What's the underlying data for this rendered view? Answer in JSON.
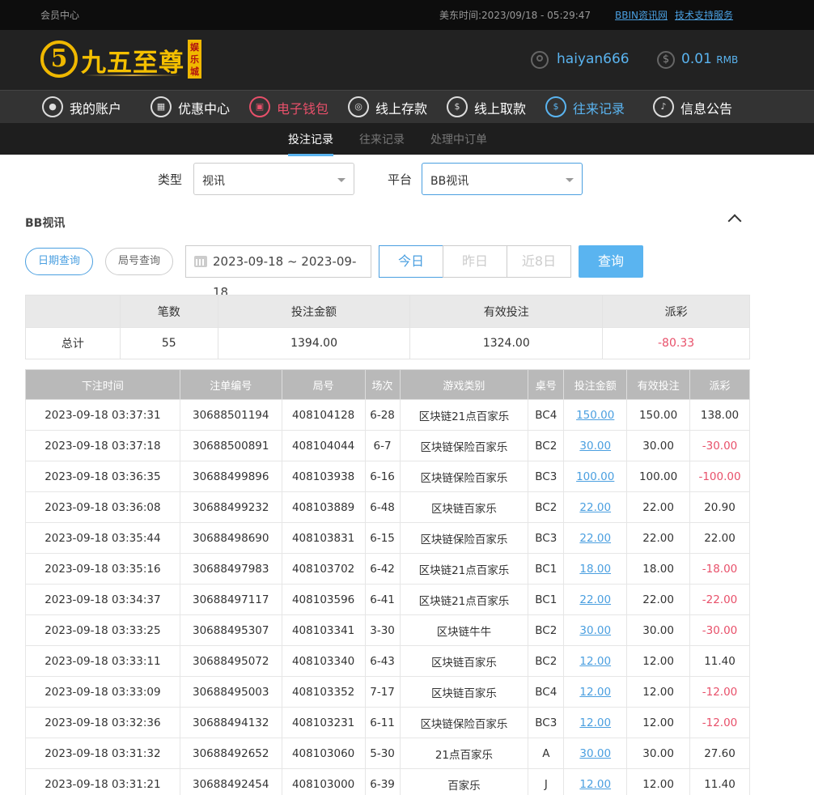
{
  "topbar": {
    "member_center": "会员中心",
    "time_label": "美东时间:",
    "time_value": "2023/09/18 - 05:29:47",
    "link1": "BBIN资讯网",
    "link2": "技术支持服务"
  },
  "logo": {
    "digit": "5",
    "name": "九五至尊",
    "tag": "娱乐城"
  },
  "user": {
    "username": "haiyan666",
    "balance": "0.01",
    "currency": "RMB"
  },
  "nav": [
    {
      "label": "我的账户",
      "icon": "user-icon"
    },
    {
      "label": "优惠中心",
      "icon": "gift-icon"
    },
    {
      "label": "电子钱包",
      "icon": "wallet-icon"
    },
    {
      "label": "线上存款",
      "icon": "deposit-icon"
    },
    {
      "label": "线上取款",
      "icon": "withdraw-icon"
    },
    {
      "label": "往来记录",
      "icon": "records-icon"
    },
    {
      "label": "信息公告",
      "icon": "bell-icon"
    }
  ],
  "subtabs": [
    "投注记录",
    "往来记录",
    "处理中订单"
  ],
  "filters": {
    "type_label": "类型",
    "type_value": "视讯",
    "platform_label": "平台",
    "platform_value": "BB视讯"
  },
  "section_title": "BB视讯",
  "query_modes": [
    "日期查询",
    "局号查询"
  ],
  "date_range": "2023-09-18 ~ 2023-09-18",
  "quick_dates": [
    "今日",
    "昨日",
    "近8日"
  ],
  "query_button": "查询",
  "summary": {
    "headers": [
      "",
      "笔数",
      "投注金额",
      "有效投注",
      "派彩"
    ],
    "row": [
      "总计",
      "55",
      "1394.00",
      "1324.00",
      "-80.33"
    ]
  },
  "records": {
    "headers": [
      "下注时间",
      "注单编号",
      "局号",
      "场次",
      "游戏类别",
      "桌号",
      "投注金额",
      "有效投注",
      "派彩"
    ],
    "rows": [
      [
        "2023-09-18 03:37:31",
        "30688501194",
        "408104128",
        "6-28",
        "区块链21点百家乐",
        "BC4",
        "150.00",
        "150.00",
        "138.00"
      ],
      [
        "2023-09-18 03:37:18",
        "30688500891",
        "408104044",
        "6-7",
        "区块链保险百家乐",
        "BC2",
        "30.00",
        "30.00",
        "-30.00"
      ],
      [
        "2023-09-18 03:36:35",
        "30688499896",
        "408103938",
        "6-16",
        "区块链保险百家乐",
        "BC3",
        "100.00",
        "100.00",
        "-100.00"
      ],
      [
        "2023-09-18 03:36:08",
        "30688499232",
        "408103889",
        "6-48",
        "区块链百家乐",
        "BC2",
        "22.00",
        "22.00",
        "20.90"
      ],
      [
        "2023-09-18 03:35:44",
        "30688498690",
        "408103831",
        "6-15",
        "区块链保险百家乐",
        "BC3",
        "22.00",
        "22.00",
        "22.00"
      ],
      [
        "2023-09-18 03:35:16",
        "30688497983",
        "408103702",
        "6-42",
        "区块链21点百家乐",
        "BC1",
        "18.00",
        "18.00",
        "-18.00"
      ],
      [
        "2023-09-18 03:34:37",
        "30688497117",
        "408103596",
        "6-41",
        "区块链21点百家乐",
        "BC1",
        "22.00",
        "22.00",
        "-22.00"
      ],
      [
        "2023-09-18 03:33:25",
        "30688495307",
        "408103341",
        "3-30",
        "区块链牛牛",
        "BC2",
        "30.00",
        "30.00",
        "-30.00"
      ],
      [
        "2023-09-18 03:33:11",
        "30688495072",
        "408103340",
        "6-43",
        "区块链百家乐",
        "BC2",
        "12.00",
        "12.00",
        "11.40"
      ],
      [
        "2023-09-18 03:33:09",
        "30688495003",
        "408103352",
        "7-17",
        "区块链百家乐",
        "BC4",
        "12.00",
        "12.00",
        "-12.00"
      ],
      [
        "2023-09-18 03:32:36",
        "30688494132",
        "408103231",
        "6-11",
        "区块链保险百家乐",
        "BC3",
        "12.00",
        "12.00",
        "-12.00"
      ],
      [
        "2023-09-18 03:31:32",
        "30688492652",
        "408103060",
        "5-30",
        "21点百家乐",
        "A",
        "30.00",
        "30.00",
        "27.60"
      ],
      [
        "2023-09-18 03:31:21",
        "30688492454",
        "408103000",
        "6-39",
        "百家乐",
        "J",
        "12.00",
        "12.00",
        "11.40"
      ]
    ]
  }
}
